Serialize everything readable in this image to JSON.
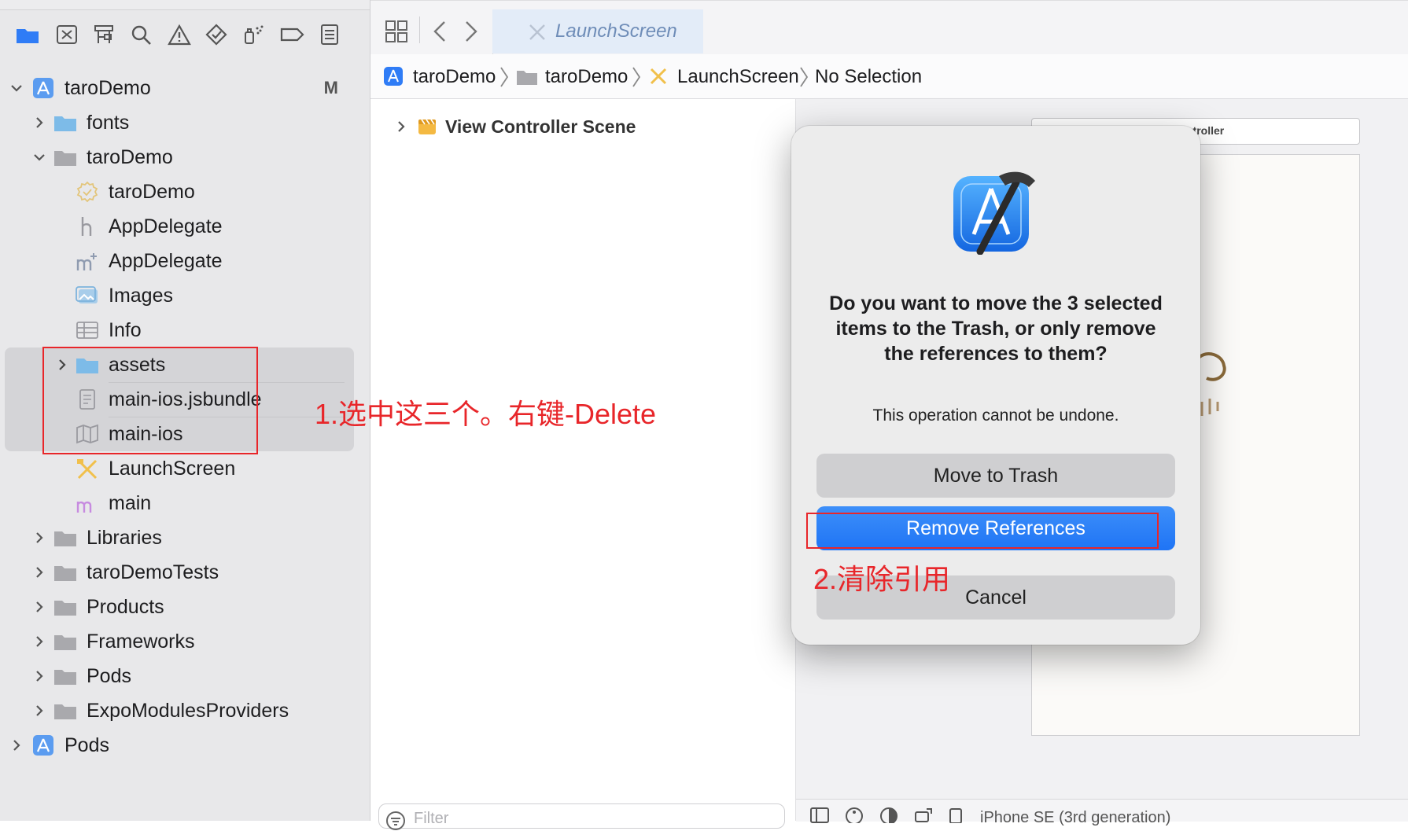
{
  "navigator": {
    "rows": [
      {
        "label": "taroDemo",
        "badge": "M"
      },
      {
        "label": "fonts"
      },
      {
        "label": "taroDemo"
      },
      {
        "label": "taroDemo"
      },
      {
        "label": "AppDelegate"
      },
      {
        "label": "AppDelegate"
      },
      {
        "label": "Images"
      },
      {
        "label": "Info"
      },
      {
        "label": "assets"
      },
      {
        "label": "main-ios.jsbundle"
      },
      {
        "label": "main-ios"
      },
      {
        "label": "LaunchScreen"
      },
      {
        "label": "main"
      },
      {
        "label": "Libraries"
      },
      {
        "label": "taroDemoTests"
      },
      {
        "label": "Products"
      },
      {
        "label": "Frameworks"
      },
      {
        "label": "Pods"
      },
      {
        "label": "ExpoModulesProviders"
      },
      {
        "label": "Pods"
      }
    ]
  },
  "tabbar": {
    "active_tab": "LaunchScreen"
  },
  "jumpbar": {
    "crumbs": [
      "taroDemo",
      "taroDemo",
      "LaunchScreen",
      "No Selection"
    ]
  },
  "outline": {
    "scene": "View Controller Scene"
  },
  "canvas": {
    "scene_title": "ntroller",
    "device": "iPhone SE (3rd generation)"
  },
  "filter": {
    "placeholder": "Filter"
  },
  "dialog": {
    "title": "Do you want to move the 3 selected items to the Trash, or only remove the references to them?",
    "message": "This operation cannot be undone.",
    "buttons": {
      "trash": "Move to Trash",
      "remove": "Remove References",
      "cancel": "Cancel"
    }
  },
  "annotations": {
    "step1": "1.选中这三个。右键-Delete",
    "step2": "2.清除引用"
  },
  "colors": {
    "accent": "#1f74f5",
    "annotation": "#e8262a",
    "folder": "#7dbbe8"
  }
}
